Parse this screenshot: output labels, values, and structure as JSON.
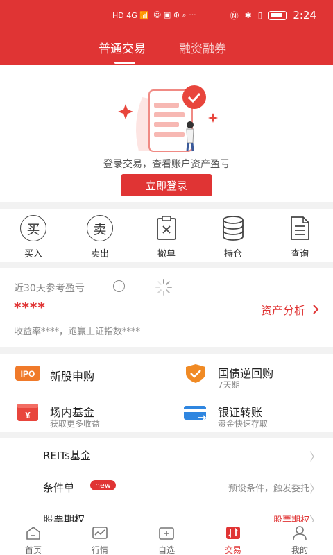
{
  "status_bar": {
    "left_icons": "HD 4G 📶",
    "time": "2:24"
  },
  "top_tabs": [
    {
      "label": "普通交易",
      "active": true
    },
    {
      "label": "融资融券",
      "active": false
    }
  ],
  "login": {
    "hint": "登录交易，查看账户资产盈亏",
    "button": "立即登录"
  },
  "trade_actions": [
    {
      "label": "买入",
      "glyph": "买",
      "icon": "buy-icon"
    },
    {
      "label": "卖出",
      "glyph": "卖",
      "icon": "sell-icon"
    },
    {
      "label": "撤单",
      "icon": "cancel-order-icon"
    },
    {
      "label": "持仓",
      "icon": "database-icon"
    },
    {
      "label": "查询",
      "icon": "document-icon"
    }
  ],
  "pnl": {
    "title": "近30天参考盈亏",
    "info": "i",
    "masked_value": "****",
    "asset_link": "资产分析",
    "subtitle": "收益率****，跑赢上证指数****"
  },
  "services": [
    {
      "name": "新股申购",
      "desc": "",
      "icon_text": "IPO"
    },
    {
      "name": "国债逆回购",
      "desc": "7天期"
    },
    {
      "name": "场内基金",
      "desc": "获取更多收益",
      "icon_text": "¥"
    },
    {
      "name": "银证转账",
      "desc": "资金快速存取"
    }
  ],
  "list_items": [
    {
      "label": "REITs基金",
      "right": ""
    },
    {
      "label": "条件单",
      "badge": "new",
      "right": "预设条件，触发委托"
    },
    {
      "label": "股票期权",
      "right": "股票期权"
    }
  ],
  "tabbar": [
    {
      "label": "首页",
      "icon": "home-icon",
      "active": false
    },
    {
      "label": "行情",
      "icon": "chart-icon",
      "active": false
    },
    {
      "label": "自选",
      "icon": "watchlist-icon",
      "active": false
    },
    {
      "label": "交易",
      "icon": "trade-icon",
      "active": true
    },
    {
      "label": "我的",
      "icon": "user-icon",
      "active": false
    }
  ],
  "colors": {
    "brand_red": "#e03434",
    "background": "#f2f2f2"
  }
}
